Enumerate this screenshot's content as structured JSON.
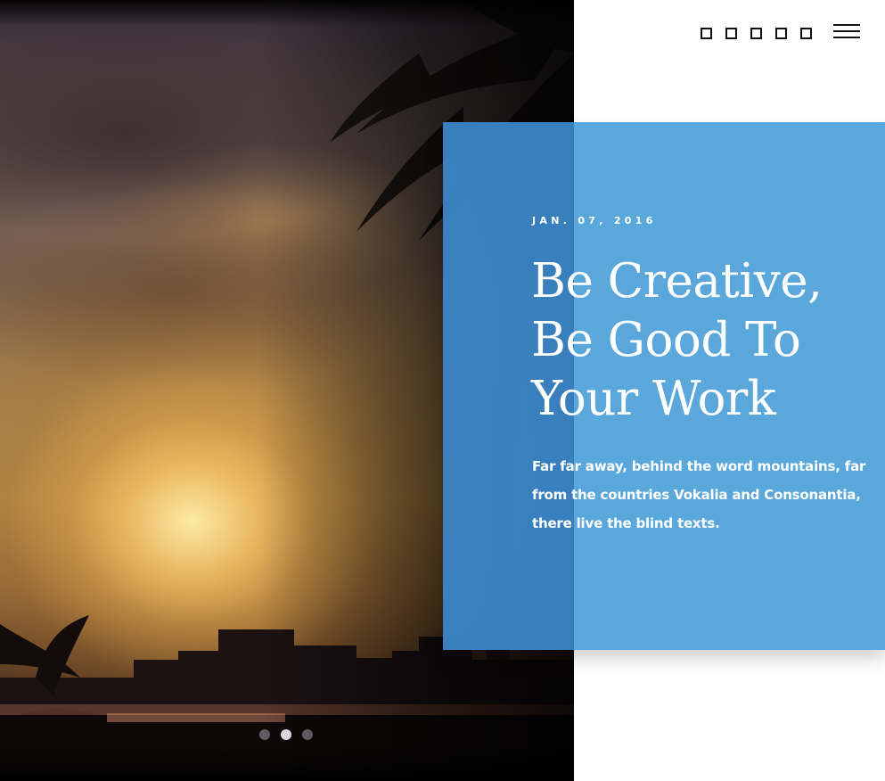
{
  "header": {
    "social_icon_names": [
      "square-icon",
      "square-icon",
      "square-icon",
      "square-icon",
      "square-icon"
    ],
    "menu_icon_name": "hamburger-menu-icon"
  },
  "slider": {
    "dot_count": 3,
    "active_dot": 2
  },
  "post": {
    "date": "JAN. 07, 2016",
    "title": "Be Creative, Be Good To Your Work",
    "excerpt": "Far far away, behind the word mountains, far from the countries Vokalia and Consonantia, there live the blind texts."
  },
  "colors": {
    "card_blue": "#53a3db",
    "text_white": "#ffffff",
    "icon_dark": "#111111",
    "dot_active": "#d8d8de",
    "dot_inactive": "#78787f"
  }
}
